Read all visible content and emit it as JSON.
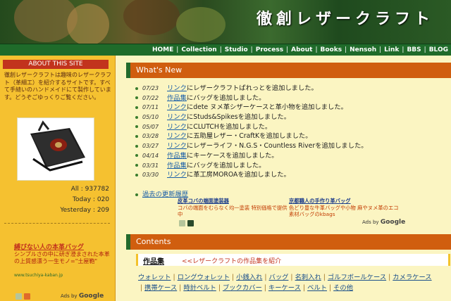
{
  "header": {
    "title": "徹創レザークラフト"
  },
  "nav": {
    "items": [
      "HOME",
      "Collection",
      "Studio",
      "Process",
      "About",
      "Books",
      "Nensoh",
      "Link",
      "BBS",
      "BLOG"
    ]
  },
  "sidebar": {
    "about_title": "ABOUT THIS SITE",
    "about_text": "徹創レザークラフトは趣味のレザークラフト（革細工）を紹介するサイトです。すべて手縫いのハンドメイドにて製作しています。どうぞごゆっくりご覧ください。",
    "counters": [
      {
        "label": "All",
        "value": "937782"
      },
      {
        "label": "Today",
        "value": "020"
      },
      {
        "label": "Yesterday",
        "value": "209"
      }
    ],
    "ad": {
      "title": "縛びない人の本革バッグ",
      "text": "シンプルさの中に研ぎ澄まされた本革の上質感漂う一生モノ=\"土屋鞄\"",
      "url": "www.tsuchiya-kaban.jp"
    },
    "ads_by": "Ads by",
    "ads_brand": "Google"
  },
  "whats_new": {
    "title": "What's New",
    "items": [
      {
        "date": "07/23",
        "link": "リンク",
        "text": "にレザークラフトぱれっとを追加しました。"
      },
      {
        "date": "07/22",
        "link": "作品集",
        "text": "にバッグを追加しました。"
      },
      {
        "date": "07/11",
        "link": "リンク",
        "text": "にdete ヌメ革シザーケースと革小物を追加しました。"
      },
      {
        "date": "05/10",
        "link": "リンク",
        "text": "にStuds&Spikesを追加しました。"
      },
      {
        "date": "05/07",
        "link": "リンク",
        "text": "にCLUTCHを追加しました。"
      },
      {
        "date": "03/28",
        "link": "リンク",
        "text": "に五助屋レザー・CraftKを追加しました。"
      },
      {
        "date": "03/27",
        "link": "リンク",
        "text": "にレザーライフ・N.G.S・Countless Riverを追加しました。"
      },
      {
        "date": "04/14",
        "link": "作品集",
        "text": "にキーケースを追加しました。"
      },
      {
        "date": "03/31",
        "link": "作品集",
        "text": "にバッグを追加しました。"
      },
      {
        "date": "03/30",
        "link": "リンク",
        "text": "に革工房MOROAを追加しました。"
      }
    ],
    "past_link": "過去の更新履歴",
    "ads": [
      {
        "title": "皮革コバの端面塗装器",
        "desc": "コバの端面をむらなく均一塗装 特別価格で提供中"
      },
      {
        "title": "京都職人の手作り革バッグ",
        "desc": "色どり豊な牛革バッグや小物 麻やヌメ革のエコ素材バッグのkbags"
      }
    ],
    "ads_by": "Ads by",
    "ads_brand": "Google"
  },
  "contents": {
    "title": "Contents",
    "category_name": "作品集",
    "category_desc": "<<レザークラフトの作品集を紹介",
    "links": [
      "ウォレット",
      "ロングウォレット",
      "小銭入れ",
      "バッグ",
      "名刺入れ",
      "ゴルフボールケース",
      "カメラケース",
      "携帯ケース",
      "時計ベルト",
      "ブックカバー",
      "キーケース",
      "ベルト",
      "その他"
    ]
  },
  "colors": {
    "accent_orange": "#d05e0f",
    "nav_green": "#1f6b2a",
    "sidebar_yellow": "#f5c130",
    "page_bg": "#fbf5c2"
  }
}
